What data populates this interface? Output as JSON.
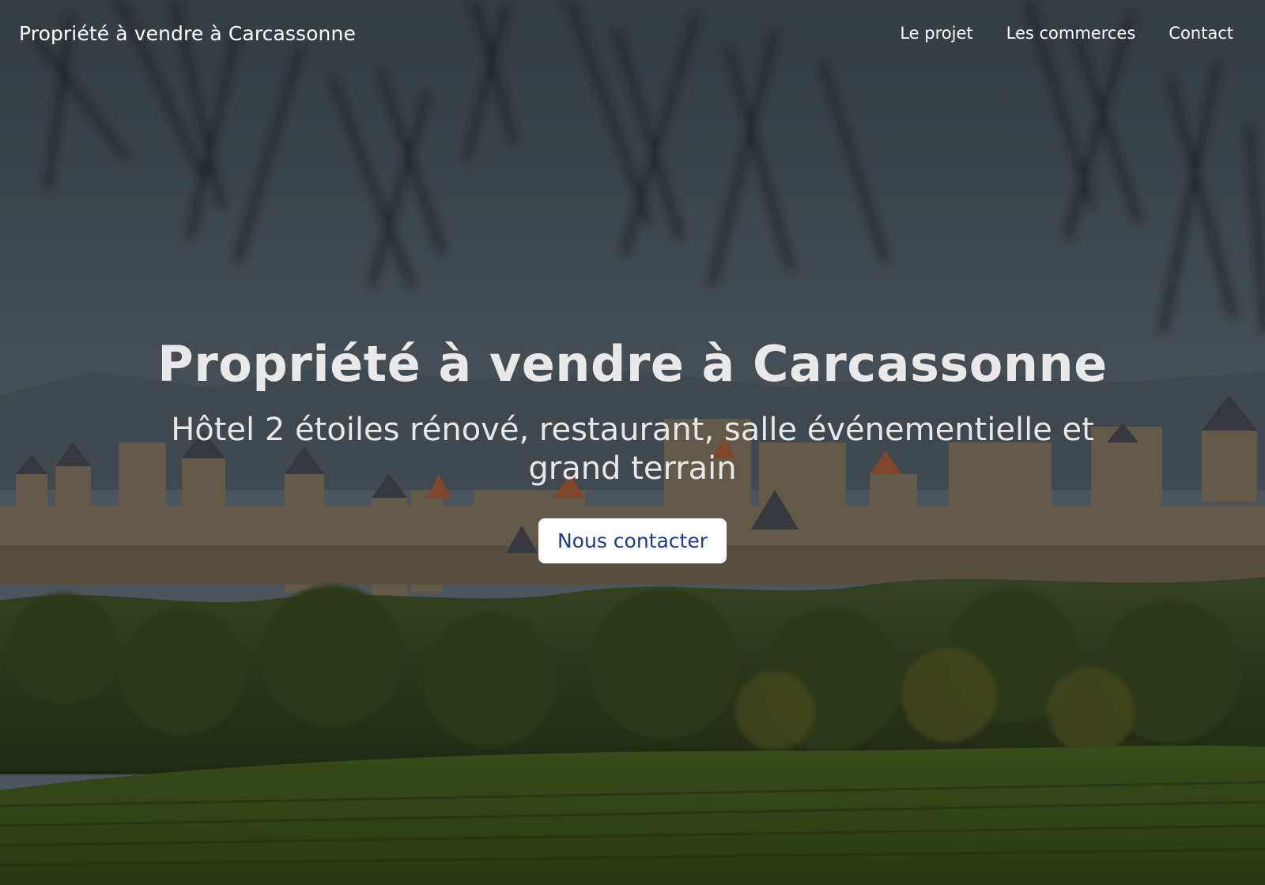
{
  "header": {
    "brand": "Propriété à vendre à Carcassonne",
    "nav": [
      {
        "label": "Le projet"
      },
      {
        "label": "Les commerces"
      },
      {
        "label": "Contact"
      }
    ]
  },
  "hero": {
    "title": "Propriété à vendre à Carcassonne",
    "subtitle": "Hôtel 2 étoiles rénové, restaurant, salle événementielle et grand terrain",
    "cta_label": "Nous contacter"
  },
  "colors": {
    "text": "#ffffff",
    "cta_text": "#1a3a8a",
    "cta_background": "#ffffff"
  },
  "icons": []
}
